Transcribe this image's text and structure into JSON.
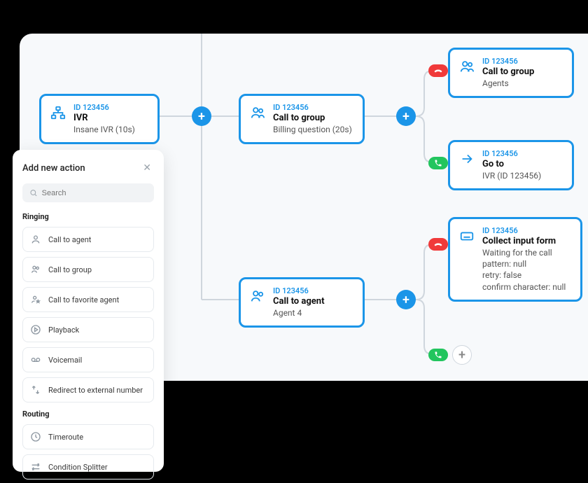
{
  "panel": {
    "title": "Add new action",
    "search_placeholder": "Search",
    "sections": {
      "ringing": {
        "label": "Ringing",
        "items": [
          "Call to agent",
          "Call to group",
          "Call to favorite agent",
          "Playback",
          "Voicemail",
          "Redirect to external number"
        ]
      },
      "routing": {
        "label": "Routing",
        "items": [
          "Timeroute",
          "Condition Splitter"
        ]
      }
    }
  },
  "nodes": {
    "ivr": {
      "id": "ID 123456",
      "title": "IVR",
      "sub": "Insane IVR (10s)"
    },
    "group_billing": {
      "id": "ID 123456",
      "title": "Call to group",
      "sub": "Billing question (20s)"
    },
    "group_agents": {
      "id": "ID 123456",
      "title": "Call to group",
      "sub": "Agents"
    },
    "goto": {
      "id": "ID 123456",
      "title": "Go to",
      "sub": "IVR (ID 123456)"
    },
    "collect": {
      "id": "ID 123456",
      "title": "Collect input form",
      "sub": "Waiting for the call\npattern: null\nretry: false\nconfirm character: null"
    },
    "agent4": {
      "id": "ID 123456",
      "title": "Call to agent",
      "sub": "Agent 4"
    }
  }
}
